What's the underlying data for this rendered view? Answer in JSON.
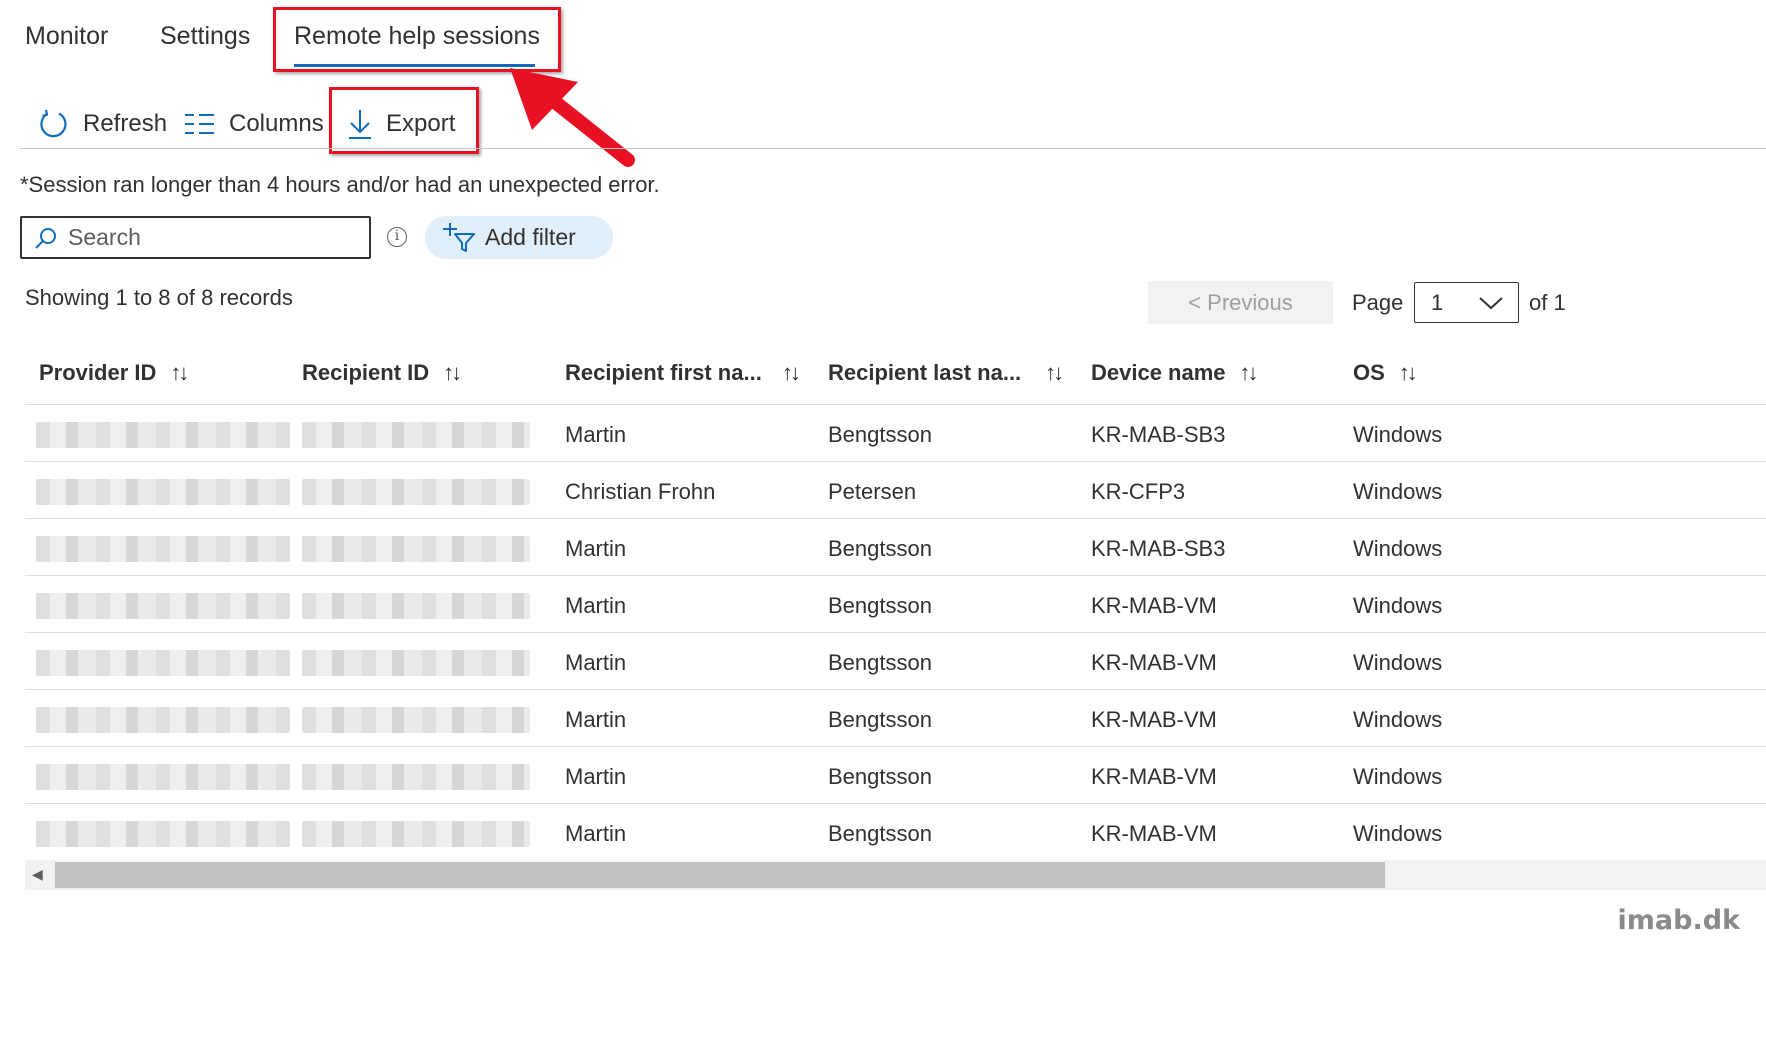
{
  "tabs": [
    {
      "label": "Monitor"
    },
    {
      "label": "Settings"
    },
    {
      "label": "Remote help sessions",
      "active": true
    }
  ],
  "toolbar": {
    "refresh_label": "Refresh",
    "columns_label": "Columns",
    "export_label": "Export"
  },
  "note": "*Session ran longer than 4 hours and/or had an unexpected error.",
  "search": {
    "placeholder": "Search"
  },
  "add_filter_label": "Add filter",
  "showing": "Showing 1 to 8 of 8 records",
  "pagination": {
    "previous_label": "< Previous",
    "page_label": "Page",
    "page_value": "1",
    "of_label": "of 1"
  },
  "table": {
    "columns": [
      "Provider ID",
      "Recipient ID",
      "Recipient first na...",
      "Recipient last na...",
      "Device name",
      "OS"
    ],
    "sort_glyph": "↑↓",
    "rows": [
      {
        "first": "Martin",
        "last": "Bengtsson",
        "device": "KR-MAB-SB3",
        "os": "Windows"
      },
      {
        "first": "Christian Frohn",
        "last": "Petersen",
        "device": "KR-CFP3",
        "os": "Windows"
      },
      {
        "first": "Martin",
        "last": "Bengtsson",
        "device": "KR-MAB-SB3",
        "os": "Windows"
      },
      {
        "first": "Martin",
        "last": "Bengtsson",
        "device": "KR-MAB-VM",
        "os": "Windows"
      },
      {
        "first": "Martin",
        "last": "Bengtsson",
        "device": "KR-MAB-VM",
        "os": "Windows"
      },
      {
        "first": "Martin",
        "last": "Bengtsson",
        "device": "KR-MAB-VM",
        "os": "Windows"
      },
      {
        "first": "Martin",
        "last": "Bengtsson",
        "device": "KR-MAB-VM",
        "os": "Windows"
      },
      {
        "first": "Martin",
        "last": "Bengtsson",
        "device": "KR-MAB-VM",
        "os": "Windows"
      }
    ]
  },
  "watermark": "imab.dk",
  "colors": {
    "accent": "#0f6cbd",
    "highlight": "#e81123",
    "filter_bg": "#e1effa"
  },
  "icons": [
    "refresh-icon",
    "columns-icon",
    "export-icon",
    "search-icon",
    "info-icon",
    "add-filter-icon",
    "chevron-down-icon",
    "sort-icon",
    "arrow-annotation"
  ]
}
